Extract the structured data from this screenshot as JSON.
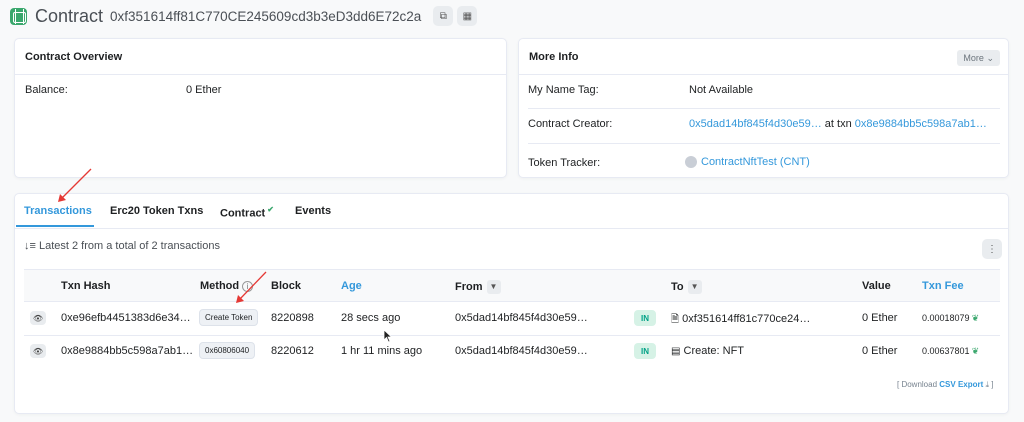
{
  "header": {
    "title": "Contract",
    "address": "0xf351614ff81C770CE245609cd3b3eD3dd6E72c2a",
    "copy_icon": "copy-icon",
    "qr_icon": "qr-code-icon"
  },
  "overview": {
    "title": "Contract Overview",
    "balance_label": "Balance:",
    "balance_value": "0 Ether"
  },
  "more_info": {
    "title": "More Info",
    "more_button": "More",
    "name_tag_label": "My Name Tag:",
    "name_tag_value": "Not Available",
    "creator_label": "Contract Creator:",
    "creator_address": "0x5dad14bf845f4d30e59…",
    "creator_at_txn": "at txn",
    "creator_txn": "0x8e9884bb5c598a7ab1…",
    "tracker_label": "Token Tracker:",
    "tracker_value": "ContractNftTest (CNT)"
  },
  "tabs": [
    {
      "label": "Transactions",
      "active": true
    },
    {
      "label": "Erc20 Token Txns",
      "active": false
    },
    {
      "label": "Contract",
      "active": false,
      "verified": "✔"
    },
    {
      "label": "Events",
      "active": false
    }
  ],
  "summary": "Latest 2 from a total of 2 transactions",
  "table": {
    "columns": [
      "Txn Hash",
      "Method",
      "Block",
      "Age",
      "From",
      "To",
      "Value",
      "Txn Fee"
    ],
    "rows": [
      {
        "hash": "0xe96efb4451383d6e34…",
        "method": "Create Token",
        "block": "8220898",
        "age": "28 secs ago",
        "from": "0x5dad14bf845f4d30e59…",
        "direction": "IN",
        "to": "0xf351614ff81c770ce24…",
        "value": "0 Ether",
        "fee": "0.00018079"
      },
      {
        "hash": "0x8e9884bb5c598a7ab1…",
        "method": "0x60806040",
        "block": "8220612",
        "age": "1 hr 11 mins ago",
        "from": "0x5dad14bf845f4d30e59…",
        "direction": "IN",
        "to": "Create: NFT",
        "value": "0 Ether",
        "fee": "0.00637801"
      }
    ]
  },
  "footer": {
    "download_prefix": "[ Download",
    "download_link": "CSV Export",
    "download_suffix": "]"
  },
  "colors": {
    "accent": "#3498db",
    "annotation_arrow": "#e53935",
    "in_badge": "#00a186"
  }
}
